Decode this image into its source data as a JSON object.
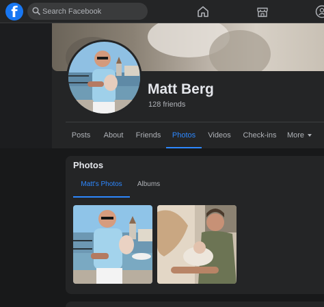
{
  "topbar": {
    "logo_letter": "f",
    "search_placeholder": "Search Facebook",
    "icons": [
      "home-icon",
      "marketplace-icon",
      "groups-icon"
    ]
  },
  "profile": {
    "name": "Matt Berg",
    "friends": "128 friends"
  },
  "tabs": [
    {
      "label": "Posts"
    },
    {
      "label": "About"
    },
    {
      "label": "Friends"
    },
    {
      "label": "Photos",
      "active": true
    },
    {
      "label": "Videos"
    },
    {
      "label": "Check-ins"
    },
    {
      "label": "More"
    }
  ],
  "photos": {
    "title": "Photos",
    "subtabs": [
      {
        "label": "Matt's Photos",
        "active": true
      },
      {
        "label": "Albums"
      }
    ]
  },
  "colors": {
    "accent": "#2d88ff",
    "brand": "#1877f2",
    "background": "#18191a",
    "surface": "#242526"
  }
}
